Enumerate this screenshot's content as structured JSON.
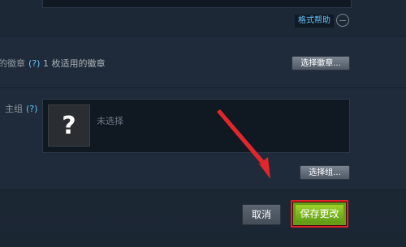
{
  "format_help": {
    "label": "格式帮助"
  },
  "badge": {
    "label": "的徽章",
    "help": "(?)",
    "count_text": "1 枚适用的徽章",
    "select_label": "选择徽章..."
  },
  "group": {
    "label": "主组",
    "help": "(?)",
    "placeholder_glyph": "?",
    "none_text": "未选择",
    "select_label": "选择组..."
  },
  "actions": {
    "cancel_label": "取消",
    "save_label": "保存更改"
  },
  "colors": {
    "accent_blue": "#66c0f4",
    "save_green": "#7cbf1c",
    "highlight_red": "#e0222a"
  }
}
